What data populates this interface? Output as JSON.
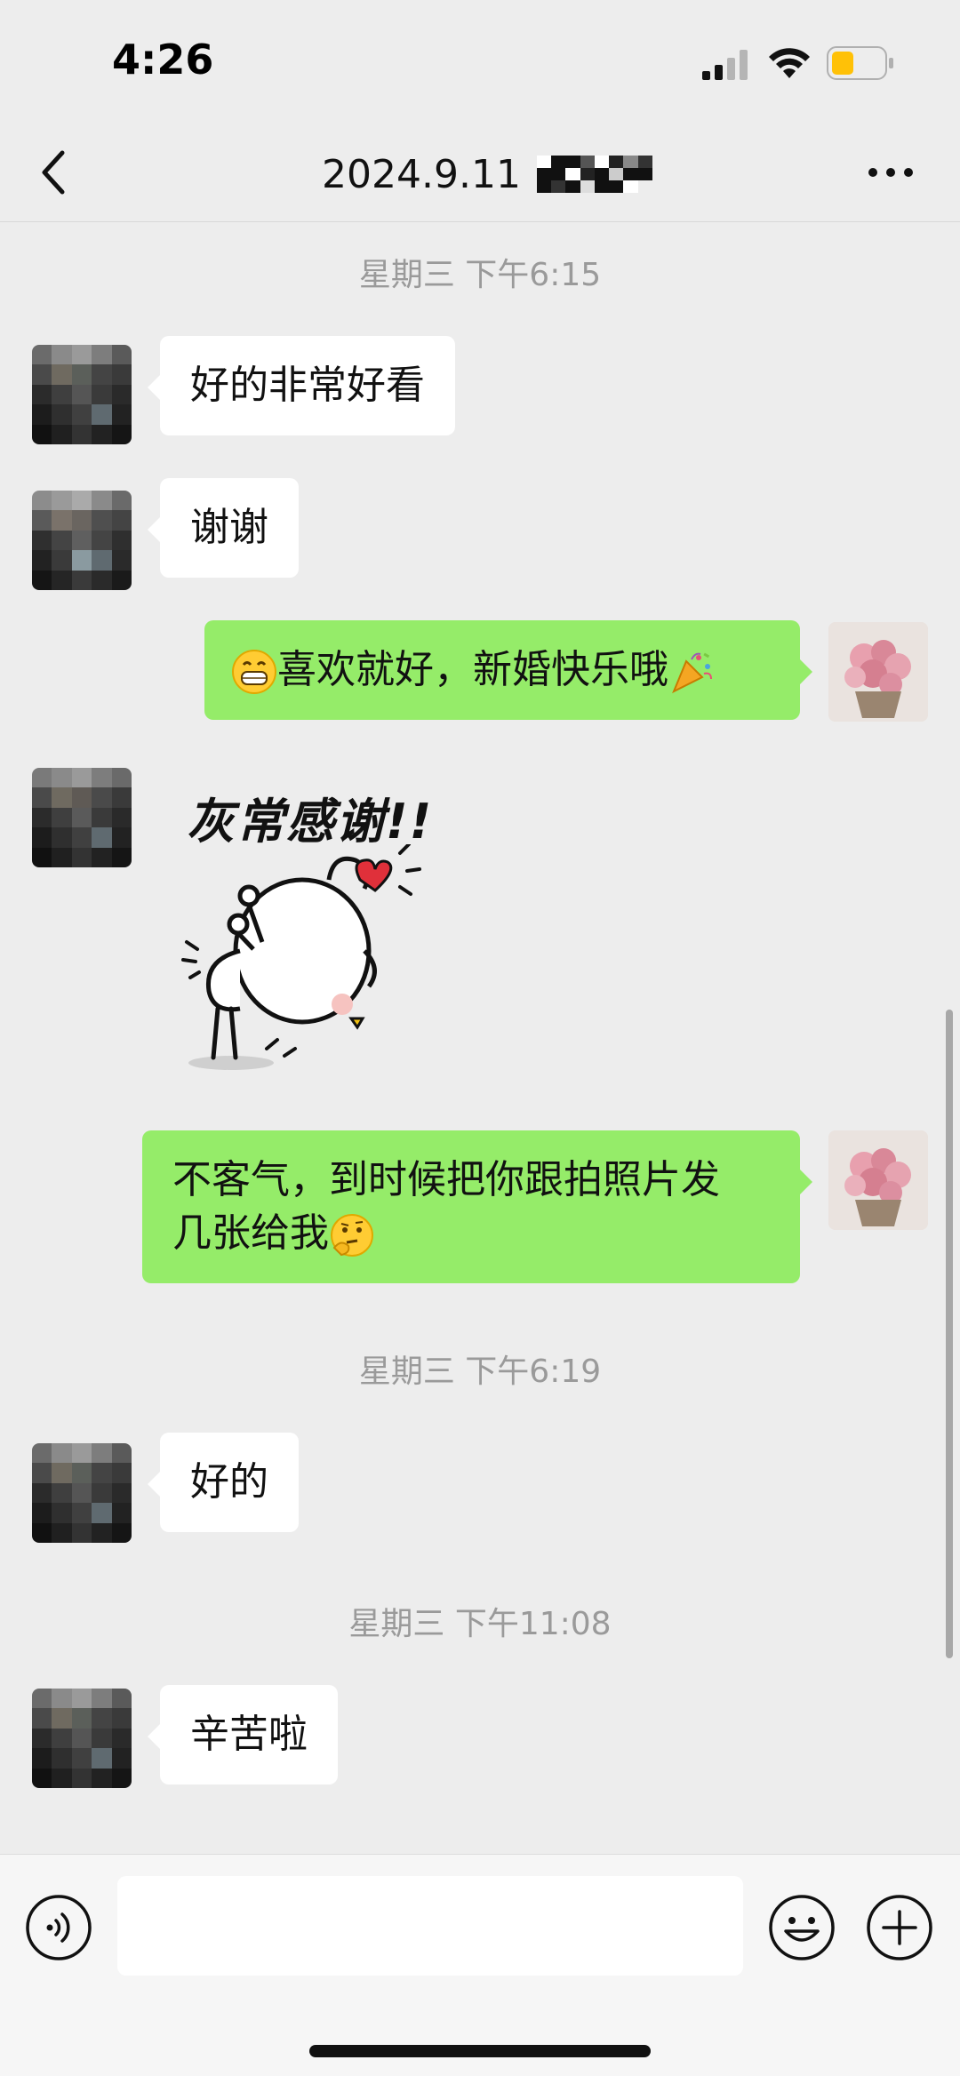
{
  "status_bar": {
    "time": "4:26",
    "battery_color": "#ffc107"
  },
  "nav": {
    "title": "2024.9.11",
    "back_icon": "chevron-left-icon",
    "more_icon": "more-icon"
  },
  "messages": [
    {
      "kind": "timestamp",
      "text": "星期三 下午6:15"
    },
    {
      "kind": "incoming",
      "text": "好的非常好看"
    },
    {
      "kind": "incoming",
      "text": "谢谢"
    },
    {
      "kind": "outgoing",
      "text": "喜欢就好，新婚快乐哦",
      "emoji_before": "grin-emoji-icon",
      "emoji_after": "party-popper-icon"
    },
    {
      "kind": "sticker",
      "text": "灰常感谢!!"
    },
    {
      "kind": "outgoing",
      "line1": "不客气，到时候把你跟拍照片发",
      "line2": "几张给我",
      "emoji_after": "thinking-emoji-icon"
    },
    {
      "kind": "timestamp",
      "text": "星期三 下午6:19"
    },
    {
      "kind": "incoming",
      "text": "好的"
    },
    {
      "kind": "timestamp",
      "text": "星期三 下午11:08"
    },
    {
      "kind": "incoming",
      "text": "辛苦啦"
    }
  ],
  "input": {
    "value": "",
    "placeholder": ""
  },
  "colors": {
    "background": "#ededed",
    "outgoing_bubble": "#95ec69",
    "incoming_bubble": "#ffffff"
  }
}
